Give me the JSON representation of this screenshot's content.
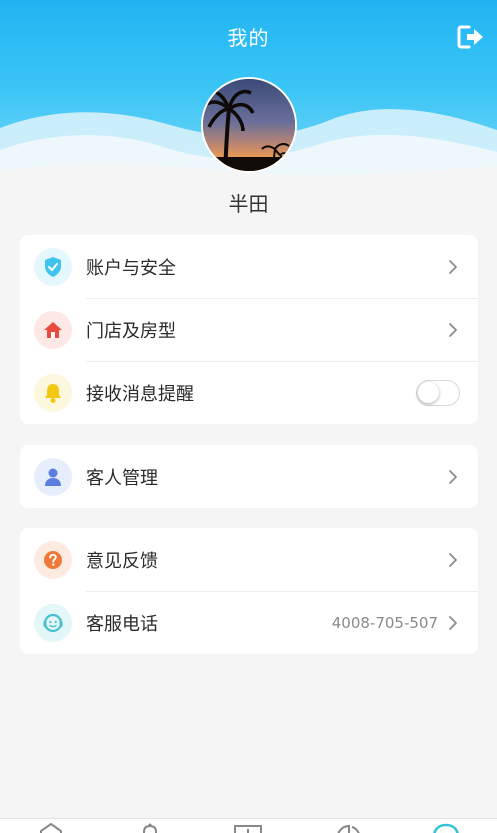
{
  "header": {
    "title": "我的",
    "logout_icon": "logout-icon"
  },
  "profile": {
    "username": "半田",
    "avatar": "palm-tree-sunset-avatar"
  },
  "groups": [
    {
      "items": [
        {
          "label": "账户与安全",
          "icon": "shield-check-icon",
          "color": "#3fc4ee",
          "bg": "#e4f7fd",
          "type": "link"
        },
        {
          "label": "门店及房型",
          "icon": "house-icon",
          "color": "#ea4b3f",
          "bg": "#fde8e6",
          "type": "link"
        },
        {
          "label": "接收消息提醒",
          "icon": "bell-icon",
          "color": "#f3c812",
          "bg": "#fdf7dd",
          "type": "toggle",
          "enabled": false
        }
      ]
    },
    {
      "items": [
        {
          "label": "客人管理",
          "icon": "person-icon",
          "color": "#5d7ee0",
          "bg": "#e6edfb",
          "type": "link"
        }
      ]
    },
    {
      "items": [
        {
          "label": "意见反馈",
          "icon": "question-icon",
          "color": "#ef7a37",
          "bg": "#fdebe1",
          "type": "link"
        },
        {
          "label": "客服电话",
          "icon": "customer-service-icon",
          "color": "#47bfcf",
          "bg": "#e3f6f8",
          "type": "link",
          "value": "4008-705-507"
        }
      ]
    }
  ],
  "colors": {
    "header_start": "#21b4f2",
    "header_end": "#7fdaf8",
    "background": "#f5f5f6"
  }
}
